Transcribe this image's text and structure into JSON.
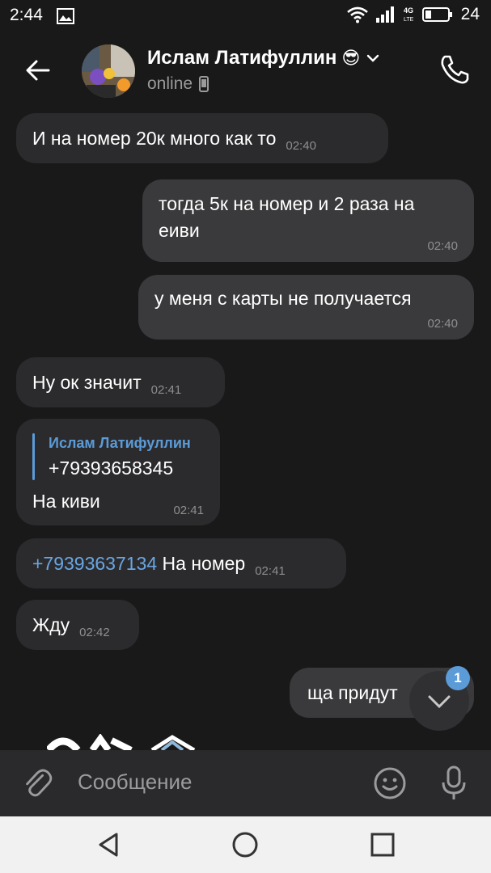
{
  "status_bar": {
    "time": "2:44",
    "network": "4G LTE",
    "battery": "24"
  },
  "header": {
    "name": "Ислам Латифуллин",
    "name_emoji": "😎",
    "presence": "online"
  },
  "messages": [
    {
      "dir": "in",
      "text": "И на номер 20к много как то",
      "time": "02:40"
    },
    {
      "dir": "out",
      "text": "тогда 5к на номер и 2 раза на еиви",
      "time": "02:40"
    },
    {
      "dir": "out",
      "text": "у меня с карты не получается",
      "time": "02:40"
    },
    {
      "dir": "in",
      "text": "Ну ок значит",
      "time": "02:41"
    },
    {
      "dir": "in",
      "reply_author": "Ислам Латифуллин",
      "reply_text": "+79393658345",
      "text": "На киви",
      "time": "02:41"
    },
    {
      "dir": "in",
      "link": "+79393637134",
      "text": "На номер",
      "time": "02:41"
    },
    {
      "dir": "in",
      "text": "Жду",
      "time": "02:42"
    },
    {
      "dir": "out",
      "text": "ща придут"
    }
  ],
  "scroll": {
    "unread_count": "1"
  },
  "composer": {
    "placeholder": "Сообщение"
  },
  "colors": {
    "accent": "#5b9bd8",
    "background": "#19191a",
    "incoming": "#2b2b2d",
    "outgoing": "#3a3a3c"
  }
}
